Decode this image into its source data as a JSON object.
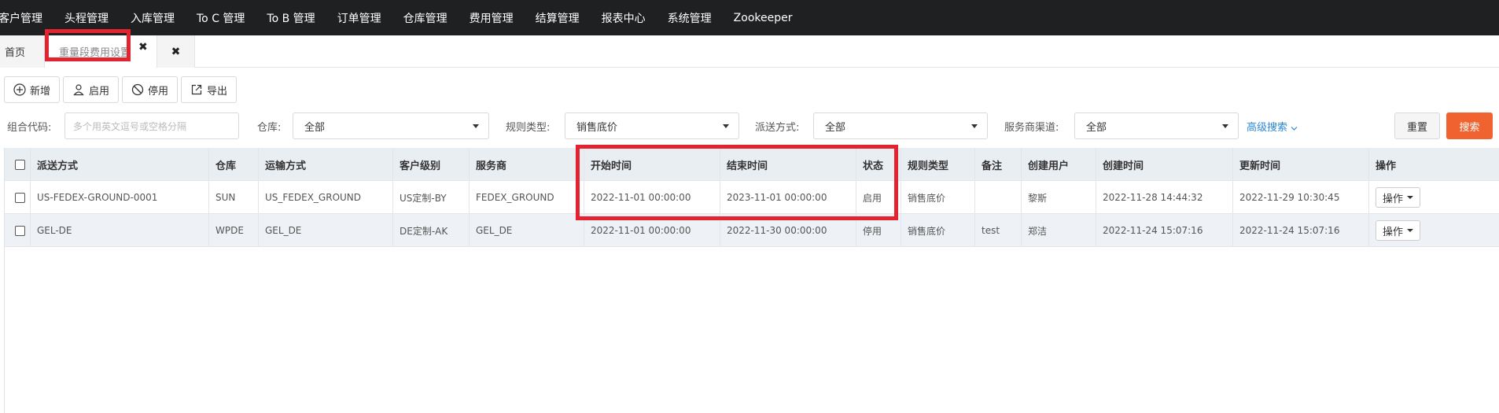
{
  "topnav": {
    "items": [
      "客户管理",
      "头程管理",
      "入库管理",
      "To C 管理",
      "To B 管理",
      "订单管理",
      "仓库管理",
      "费用管理",
      "结算管理",
      "报表中心",
      "系统管理",
      "Zookeeper"
    ]
  },
  "tabs": {
    "home": "首页",
    "active": "重量段费用设置",
    "close_glyph": "✖"
  },
  "toolbar": {
    "add": "新增",
    "enable": "启用",
    "disable": "停用",
    "export": "导出"
  },
  "filters": {
    "combo_code_label": "组合代码:",
    "combo_code_placeholder": "多个用英文逗号或空格分隔",
    "warehouse_label": "仓库:",
    "warehouse_value": "全部",
    "rule_type_label": "规则类型:",
    "rule_type_value": "销售底价",
    "delivery_label": "派送方式:",
    "delivery_value": "全部",
    "channel_label": "服务商渠道:",
    "channel_value": "全部",
    "advanced": "高级搜索",
    "reset": "重置",
    "search": "搜索"
  },
  "table": {
    "columns": [
      "派送方式",
      "仓库",
      "运输方式",
      "客户级别",
      "服务商",
      "开始时间",
      "结束时间",
      "状态",
      "规则类型",
      "备注",
      "创建用户",
      "创建时间",
      "更新时间",
      "操作"
    ],
    "rows": [
      {
        "delivery": "US-FEDEX-GROUND-0001",
        "warehouse": "SUN",
        "transport": "US_FEDEX_GROUND",
        "level": "US定制-BY",
        "provider": "FEDEX_GROUND",
        "start": "2022-11-01 00:00:00",
        "end": "2023-11-01 00:00:00",
        "status": "启用",
        "rule_type": "销售底价",
        "remark": "",
        "creator": "黎斯",
        "created": "2022-11-28 14:44:32",
        "updated": "2022-11-29 10:30:45",
        "action": "操作"
      },
      {
        "delivery": "GEL-DE",
        "warehouse": "WPDE",
        "transport": "GEL_DE",
        "level": "DE定制-AK",
        "provider": "GEL_DE",
        "start": "2022-11-01 00:00:00",
        "end": "2022-11-30 00:00:00",
        "status": "停用",
        "rule_type": "销售底价",
        "remark": "test",
        "creator": "郑洁",
        "created": "2022-11-24 15:07:16",
        "updated": "2022-11-24 15:07:16",
        "action": "操作"
      }
    ]
  },
  "colors": {
    "nav_bg": "#1f2022",
    "highlight_red": "#e3232f",
    "search_orange": "#f0622f",
    "link_blue": "#2b88d8"
  },
  "icons": {
    "add": "plus-circle-icon",
    "enable": "user-icon",
    "disable": "ban-icon",
    "export": "export-icon",
    "close": "close-icon",
    "caret": "caret-down-icon"
  }
}
